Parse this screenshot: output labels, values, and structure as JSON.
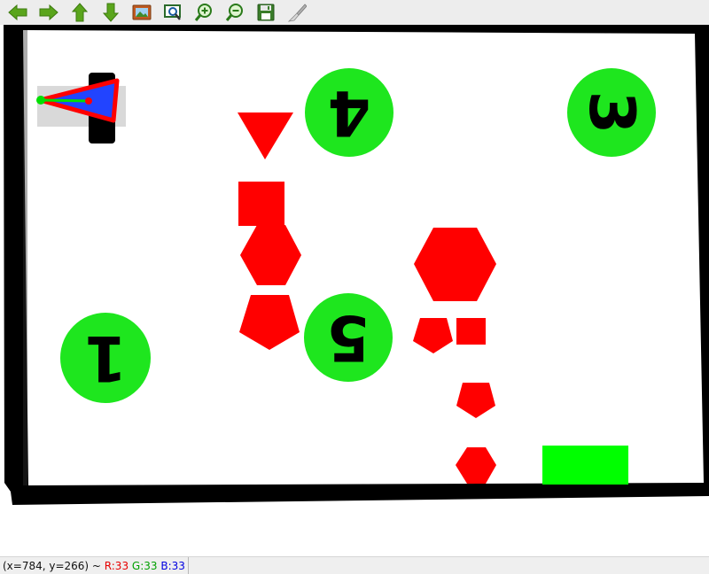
{
  "toolbar": {
    "buttons": [
      {
        "name": "pan-left-button",
        "icon": "arrow-left-icon",
        "color": "#5aa51c"
      },
      {
        "name": "pan-right-button",
        "icon": "arrow-right-icon",
        "color": "#5aa51c"
      },
      {
        "name": "pan-up-button",
        "icon": "arrow-up-icon",
        "color": "#5aa51c"
      },
      {
        "name": "pan-down-button",
        "icon": "arrow-down-icon",
        "color": "#5aa51c"
      },
      {
        "name": "zoom-image-button",
        "icon": "image-icon",
        "color": "#c05a20"
      },
      {
        "name": "zoom-fit-button",
        "icon": "zoom-region-icon",
        "color": "#2a6a2a"
      },
      {
        "name": "zoom-in-button",
        "icon": "zoom-in-icon",
        "color": "#2a7a1a"
      },
      {
        "name": "zoom-out-button",
        "icon": "zoom-out-icon",
        "color": "#2a7a1a"
      },
      {
        "name": "save-button",
        "icon": "floppy-disk-icon",
        "color": "#3a7d2a"
      },
      {
        "name": "properties-button",
        "icon": "brush-icon",
        "color": "#9a9a9a"
      }
    ]
  },
  "scene": {
    "colors": {
      "shape": "#ff0000",
      "marker": "#1ee61e",
      "wall": "#000000",
      "robot_body": "#2244ff",
      "goal": "#00ff00"
    },
    "markers": [
      {
        "id": "marker-1",
        "label": "1",
        "glyph_rotation": 180
      },
      {
        "id": "marker-3",
        "label": "3",
        "glyph_rotation": 90
      },
      {
        "id": "marker-4",
        "label": "4",
        "glyph_rotation": 180
      },
      {
        "id": "marker-5",
        "label": "5",
        "glyph_rotation": 180
      }
    ]
  },
  "status": {
    "coords": "(x=784, y=266) ~ ",
    "r": "R:33",
    "g": "G:33",
    "b": "B:33"
  }
}
